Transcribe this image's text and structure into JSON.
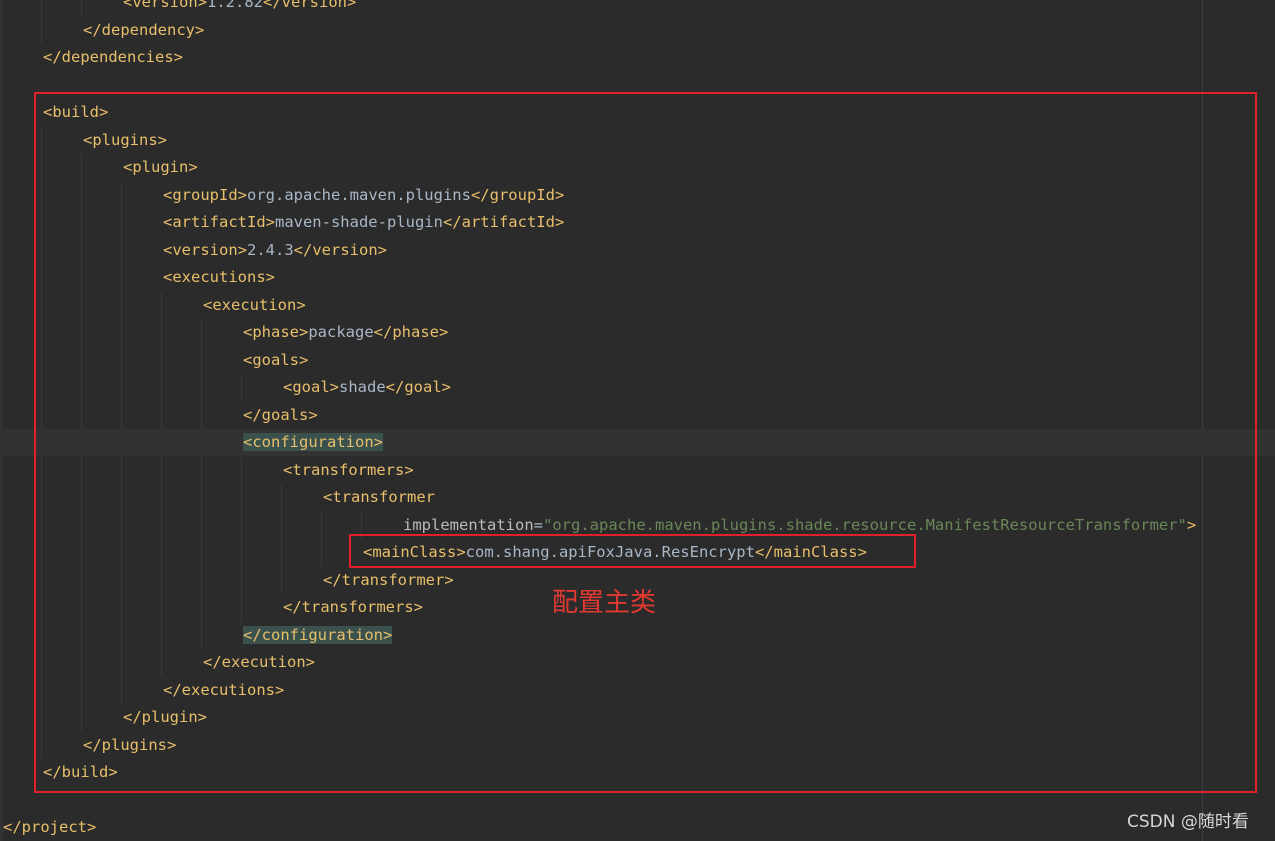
{
  "code_lines": [
    {
      "indent": 3,
      "tokens": [
        {
          "cls": "tok-tag",
          "text": "<version>"
        },
        {
          "cls": "tok-text",
          "text": "1.2.82"
        },
        {
          "cls": "tok-tag",
          "text": "</version>"
        }
      ]
    },
    {
      "indent": 2,
      "tokens": [
        {
          "cls": "tok-tag",
          "text": "</dependency>"
        }
      ]
    },
    {
      "indent": 1,
      "tokens": [
        {
          "cls": "tok-tag",
          "text": "</dependencies>"
        }
      ]
    },
    {
      "indent": 0,
      "tokens": []
    },
    {
      "indent": 1,
      "tokens": [
        {
          "cls": "tok-tag",
          "text": "<build>"
        }
      ]
    },
    {
      "indent": 2,
      "tokens": [
        {
          "cls": "tok-tag",
          "text": "<plugins>"
        }
      ]
    },
    {
      "indent": 3,
      "tokens": [
        {
          "cls": "tok-tag",
          "text": "<plugin>"
        }
      ]
    },
    {
      "indent": 4,
      "tokens": [
        {
          "cls": "tok-tag",
          "text": "<groupId>"
        },
        {
          "cls": "tok-text",
          "text": "org.apache.maven.plugins"
        },
        {
          "cls": "tok-tag",
          "text": "</groupId>"
        }
      ]
    },
    {
      "indent": 4,
      "tokens": [
        {
          "cls": "tok-tag",
          "text": "<artifactId>"
        },
        {
          "cls": "tok-text",
          "text": "maven-shade-plugin"
        },
        {
          "cls": "tok-tag",
          "text": "</artifactId>"
        }
      ]
    },
    {
      "indent": 4,
      "tokens": [
        {
          "cls": "tok-tag",
          "text": "<version>"
        },
        {
          "cls": "tok-text",
          "text": "2.4.3"
        },
        {
          "cls": "tok-tag",
          "text": "</version>"
        }
      ]
    },
    {
      "indent": 4,
      "tokens": [
        {
          "cls": "tok-tag",
          "text": "<executions>"
        }
      ]
    },
    {
      "indent": 5,
      "tokens": [
        {
          "cls": "tok-tag",
          "text": "<execution>"
        }
      ]
    },
    {
      "indent": 6,
      "tokens": [
        {
          "cls": "tok-tag",
          "text": "<phase>"
        },
        {
          "cls": "tok-text",
          "text": "package"
        },
        {
          "cls": "tok-tag",
          "text": "</phase>"
        }
      ]
    },
    {
      "indent": 6,
      "tokens": [
        {
          "cls": "tok-tag",
          "text": "<goals>"
        }
      ]
    },
    {
      "indent": 7,
      "tokens": [
        {
          "cls": "tok-tag",
          "text": "<goal>"
        },
        {
          "cls": "tok-text",
          "text": "shade"
        },
        {
          "cls": "tok-tag",
          "text": "</goal>"
        }
      ]
    },
    {
      "indent": 6,
      "tokens": [
        {
          "cls": "tok-tag",
          "text": "</goals>"
        }
      ]
    },
    {
      "indent": 6,
      "current": true,
      "tokens": [
        {
          "cls": "tok-match",
          "text": "<configuration>"
        }
      ]
    },
    {
      "indent": 7,
      "tokens": [
        {
          "cls": "tok-tag",
          "text": "<transformers>"
        }
      ]
    },
    {
      "indent": 8,
      "tokens": [
        {
          "cls": "tok-tag",
          "text": "<transformer"
        }
      ]
    },
    {
      "indent": 10,
      "tokens": [
        {
          "cls": "tok-attr",
          "text": "implementation"
        },
        {
          "cls": "tok-eq",
          "text": "="
        },
        {
          "cls": "tok-str",
          "text": "\"org.apache.maven.plugins.shade.resource.ManifestResourceTransformer\""
        },
        {
          "cls": "tok-tag",
          "text": ">"
        }
      ]
    },
    {
      "indent": 9,
      "tokens": [
        {
          "cls": "tok-tag",
          "text": "<mainClass>"
        },
        {
          "cls": "tok-text",
          "text": "com.shang.apiFoxJava.ResEncrypt"
        },
        {
          "cls": "tok-tag",
          "text": "</mainClass>"
        }
      ]
    },
    {
      "indent": 8,
      "tokens": [
        {
          "cls": "tok-tag",
          "text": "</transformer>"
        }
      ]
    },
    {
      "indent": 7,
      "tokens": [
        {
          "cls": "tok-tag",
          "text": "</transformers>"
        }
      ]
    },
    {
      "indent": 6,
      "tokens": [
        {
          "cls": "tok-match",
          "text": "</configuration>"
        }
      ]
    },
    {
      "indent": 5,
      "tokens": [
        {
          "cls": "tok-tag",
          "text": "</execution>"
        }
      ]
    },
    {
      "indent": 4,
      "tokens": [
        {
          "cls": "tok-tag",
          "text": "</executions>"
        }
      ]
    },
    {
      "indent": 3,
      "tokens": [
        {
          "cls": "tok-tag",
          "text": "</plugin>"
        }
      ]
    },
    {
      "indent": 2,
      "tokens": [
        {
          "cls": "tok-tag",
          "text": "</plugins>"
        }
      ]
    },
    {
      "indent": 1,
      "tokens": [
        {
          "cls": "tok-tag",
          "text": "</build>"
        }
      ]
    },
    {
      "indent": 0,
      "tokens": []
    },
    {
      "indent": 0,
      "tokens": [
        {
          "cls": "tok-tag",
          "text": "</project>"
        }
      ]
    }
  ],
  "annotation": {
    "text": "配置主类"
  },
  "watermark": {
    "text": "CSDN @随时看"
  },
  "colors": {
    "background": "#2b2b2b",
    "tag": "#e8bf6a",
    "text": "#a9b7c6",
    "string": "#6a8759",
    "highlight_box": "#e0202a",
    "annotation": "#e23a30"
  }
}
